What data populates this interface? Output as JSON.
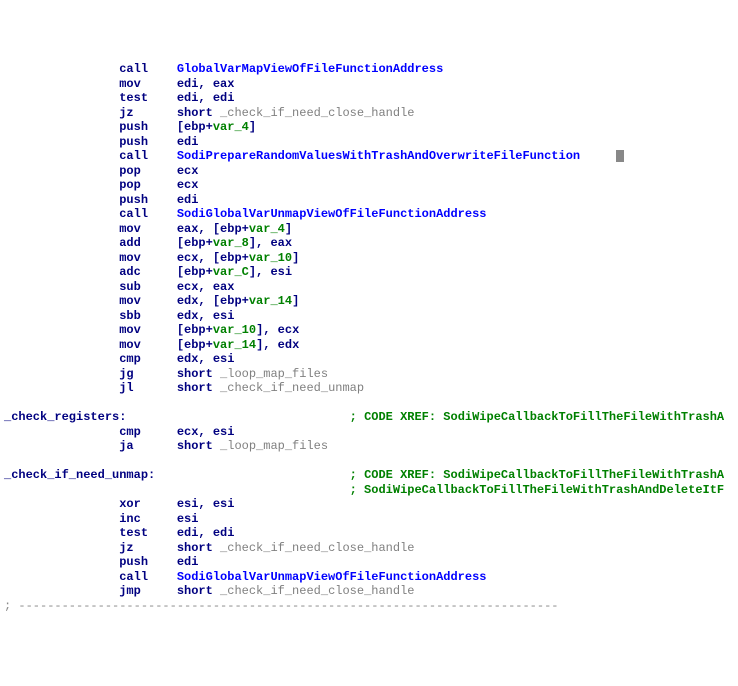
{
  "lines": [
    {
      "indent2": true,
      "mn": "call",
      "sym": "GlobalVarMapViewOfFileFunctionAddress"
    },
    {
      "indent2": true,
      "mn": "mov",
      "regs": "edi, eax"
    },
    {
      "indent2": true,
      "mn": "test",
      "regs": "edi, edi"
    },
    {
      "indent2": true,
      "mn": "jz",
      "short": true,
      "lbl": "_check_if_need_close_handle"
    },
    {
      "indent2": true,
      "mn": "push",
      "bracket_open": "[ebp+",
      "var": "var_4",
      "bracket_close": "]"
    },
    {
      "indent2": true,
      "mn": "push",
      "regs": "edi"
    },
    {
      "indent2": true,
      "mn": "call",
      "sym": "SodiPrepareRandomValuesWithTrashAndOverwriteFileFunction",
      "cursor": true
    },
    {
      "indent2": true,
      "mn": "pop",
      "regs": "ecx"
    },
    {
      "indent2": true,
      "mn": "pop",
      "regs": "ecx"
    },
    {
      "indent2": true,
      "mn": "push",
      "regs": "edi"
    },
    {
      "indent2": true,
      "mn": "call",
      "sym": "SodiGlobalVarUnmapViewOfFileFunctionAddress"
    },
    {
      "indent2": true,
      "mn": "mov",
      "regs_pre": "eax, ",
      "bracket_open": "[ebp+",
      "var": "var_4",
      "bracket_close": "]"
    },
    {
      "indent2": true,
      "mn": "add",
      "bracket_open": "[ebp+",
      "var": "var_8",
      "bracket_close": "], ",
      "regs_post": "eax"
    },
    {
      "indent2": true,
      "mn": "mov",
      "regs_pre": "ecx, ",
      "bracket_open": "[ebp+",
      "var": "var_10",
      "bracket_close": "]"
    },
    {
      "indent2": true,
      "mn": "adc",
      "bracket_open": "[ebp+",
      "var": "var_C",
      "bracket_close": "], ",
      "regs_post": "esi"
    },
    {
      "indent2": true,
      "mn": "sub",
      "regs": "ecx, eax"
    },
    {
      "indent2": true,
      "mn": "mov",
      "regs_pre": "edx, ",
      "bracket_open": "[ebp+",
      "var": "var_14",
      "bracket_close": "]"
    },
    {
      "indent2": true,
      "mn": "sbb",
      "regs": "edx, esi"
    },
    {
      "indent2": true,
      "mn": "mov",
      "bracket_open": "[ebp+",
      "var": "var_10",
      "bracket_close": "], ",
      "regs_post": "ecx"
    },
    {
      "indent2": true,
      "mn": "mov",
      "bracket_open": "[ebp+",
      "var": "var_14",
      "bracket_close": "], ",
      "regs_post": "edx"
    },
    {
      "indent2": true,
      "mn": "cmp",
      "regs": "edx, esi"
    },
    {
      "indent2": true,
      "mn": "jg",
      "short": true,
      "lbl": "_loop_map_files"
    },
    {
      "indent2": true,
      "mn": "jl",
      "short": true,
      "lbl": "_check_if_need_unmap"
    },
    {
      "blank": true
    },
    {
      "label": "_check_registers:",
      "cmt": "; CODE XREF: SodiWipeCallbackToFillTheFileWithTrashA"
    },
    {
      "indent2": true,
      "mn": "cmp",
      "regs": "ecx, esi"
    },
    {
      "indent2": true,
      "mn": "ja",
      "short": true,
      "lbl": "_loop_map_files"
    },
    {
      "blank": true
    },
    {
      "label": "_check_if_need_unmap:",
      "cmt": "; CODE XREF: SodiWipeCallbackToFillTheFileWithTrashA"
    },
    {
      "indentlabel": true,
      "cmt": "; SodiWipeCallbackToFillTheFileWithTrashAndDeleteItF"
    },
    {
      "indent2": true,
      "mn": "xor",
      "regs": "esi, esi"
    },
    {
      "indent2": true,
      "mn": "inc",
      "regs": "esi"
    },
    {
      "indent2": true,
      "mn": "test",
      "regs": "edi, edi"
    },
    {
      "indent2": true,
      "mn": "jz",
      "short": true,
      "lbl": "_check_if_need_close_handle"
    },
    {
      "indent2": true,
      "mn": "push",
      "regs": "edi"
    },
    {
      "indent2": true,
      "mn": "call",
      "sym": "SodiGlobalVarUnmapViewOfFileFunctionAddress"
    },
    {
      "indent2": true,
      "mn": "jmp",
      "short": true,
      "lbl": "_check_if_need_close_handle"
    }
  ],
  "dash_line": "; ---------------------------------------------------------------------------",
  "short_kw": "short ",
  "blank_text": " "
}
